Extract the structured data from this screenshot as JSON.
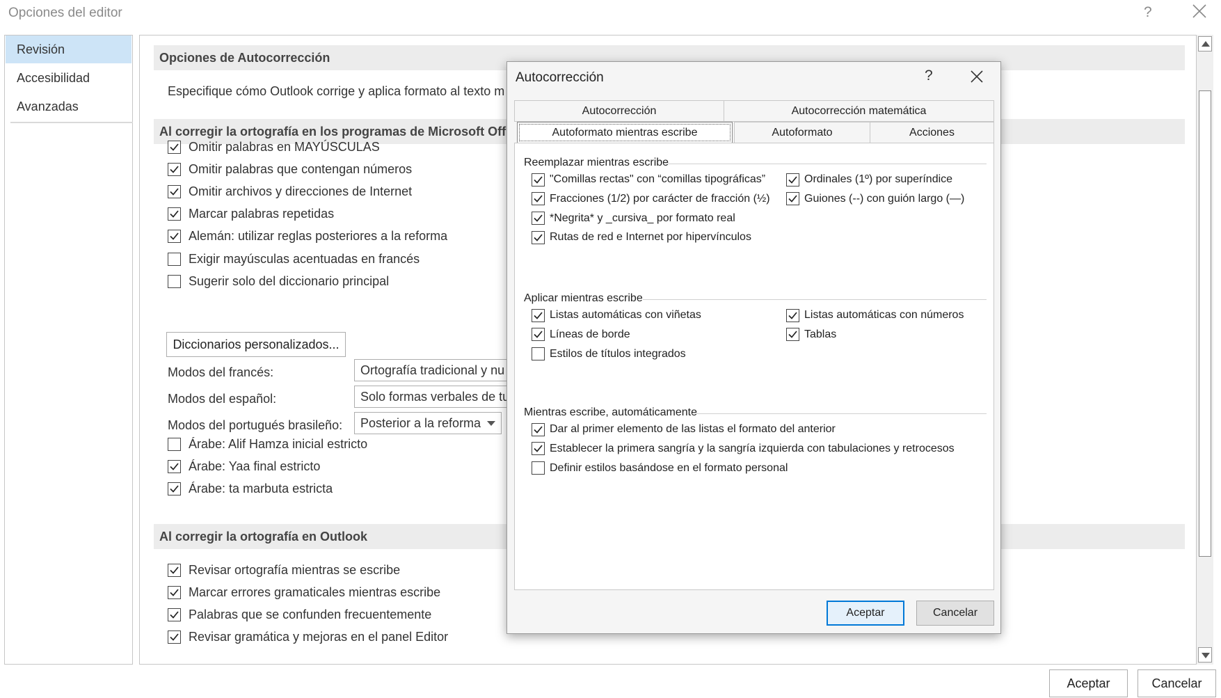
{
  "window": {
    "title": "Opciones del editor",
    "help": "?",
    "ok_label": "Aceptar",
    "cancel_label": "Cancelar"
  },
  "nav": {
    "items": [
      {
        "label": "Revisión",
        "selected": true
      },
      {
        "label": "Accesibilidad",
        "selected": false
      },
      {
        "label": "Avanzadas",
        "selected": false
      }
    ]
  },
  "main": {
    "section1_title": "Opciones de Autocorrección",
    "section1_desc": "Especifique cómo Outlook corrige y aplica formato al texto m",
    "section2_title": "Al corregir la ortografía en los programas de Microsoft Offi",
    "section2_checks": [
      {
        "label": "Omitir palabras en MAYÚSCULAS",
        "checked": true
      },
      {
        "label": "Omitir palabras que contengan números",
        "checked": true
      },
      {
        "label": "Omitir archivos y direcciones de Internet",
        "checked": true
      },
      {
        "label": "Marcar palabras repetidas",
        "checked": true
      },
      {
        "label": "Alemán: utilizar reglas posteriores a la reforma",
        "checked": true
      },
      {
        "label": "Exigir mayúsculas acentuadas en francés",
        "checked": false
      },
      {
        "label": "Sugerir solo del diccionario principal",
        "checked": false
      }
    ],
    "dictionaries_button": "Diccionarios personalizados...",
    "modes": [
      {
        "label": "Modos del francés:",
        "value": "Ortografía tradicional y nu"
      },
      {
        "label": "Modos del español:",
        "value": "Solo formas verbales de tu"
      },
      {
        "label": "Modos del portugués brasileño:",
        "value": "Posterior a la reforma"
      }
    ],
    "arabic_checks": [
      {
        "label": "Árabe: Alif Hamza inicial estricto",
        "checked": false
      },
      {
        "label": "Árabe: Yaa final estricto",
        "checked": true
      },
      {
        "label": "Árabe: ta marbuta estricta",
        "checked": true
      }
    ],
    "section3_title": "Al corregir la ortografía en Outlook",
    "section3_checks": [
      {
        "label": "Revisar ortografía mientras se escribe",
        "checked": true
      },
      {
        "label": "Marcar errores gramaticales mientras escribe",
        "checked": true
      },
      {
        "label": "Palabras que se confunden frecuentemente",
        "checked": true
      },
      {
        "label": "Revisar gramática y mejoras en el panel Editor",
        "checked": true
      }
    ]
  },
  "dialog": {
    "title": "Autocorrección",
    "help": "?",
    "tabs_row1": [
      "Autocorrección",
      "Autocorrección matemática"
    ],
    "tabs_row2": [
      "Autoformato mientras escribe",
      "Autoformato",
      "Acciones"
    ],
    "group1": {
      "title": "Reemplazar mientras escribe",
      "left": [
        {
          "label": "\"Comillas rectas\" con “comillas tipográficas”",
          "checked": true
        },
        {
          "label": "Fracciones (1/2) por carácter de fracción (½)",
          "checked": true
        },
        {
          "label": "*Negrita* y _cursiva_ por formato real",
          "checked": true
        },
        {
          "label": "Rutas de red e Internet por hipervínculos",
          "checked": true
        }
      ],
      "right": [
        {
          "label": "Ordinales (1º) por superíndice",
          "checked": true
        },
        {
          "label": "Guiones (--) con guión largo (—)",
          "checked": true
        }
      ]
    },
    "group2": {
      "title": "Aplicar mientras escribe",
      "left": [
        {
          "label": "Listas automáticas con viñetas",
          "checked": true
        },
        {
          "label": "Líneas de borde",
          "checked": true
        },
        {
          "label": "Estilos de títulos integrados",
          "checked": false
        }
      ],
      "right": [
        {
          "label": "Listas automáticas con números",
          "checked": true
        },
        {
          "label": "Tablas",
          "checked": true
        }
      ]
    },
    "group3": {
      "title": "Mientras escribe, automáticamente",
      "items": [
        {
          "label": "Dar al primer elemento de las listas el formato del anterior",
          "checked": true
        },
        {
          "label": "Establecer la primera sangría y la sangría izquierda con tabulaciones y retrocesos",
          "checked": true
        },
        {
          "label": "Definir estilos basándose en el formato personal",
          "checked": false
        }
      ]
    },
    "ok_label": "Aceptar",
    "cancel_label": "Cancelar"
  }
}
